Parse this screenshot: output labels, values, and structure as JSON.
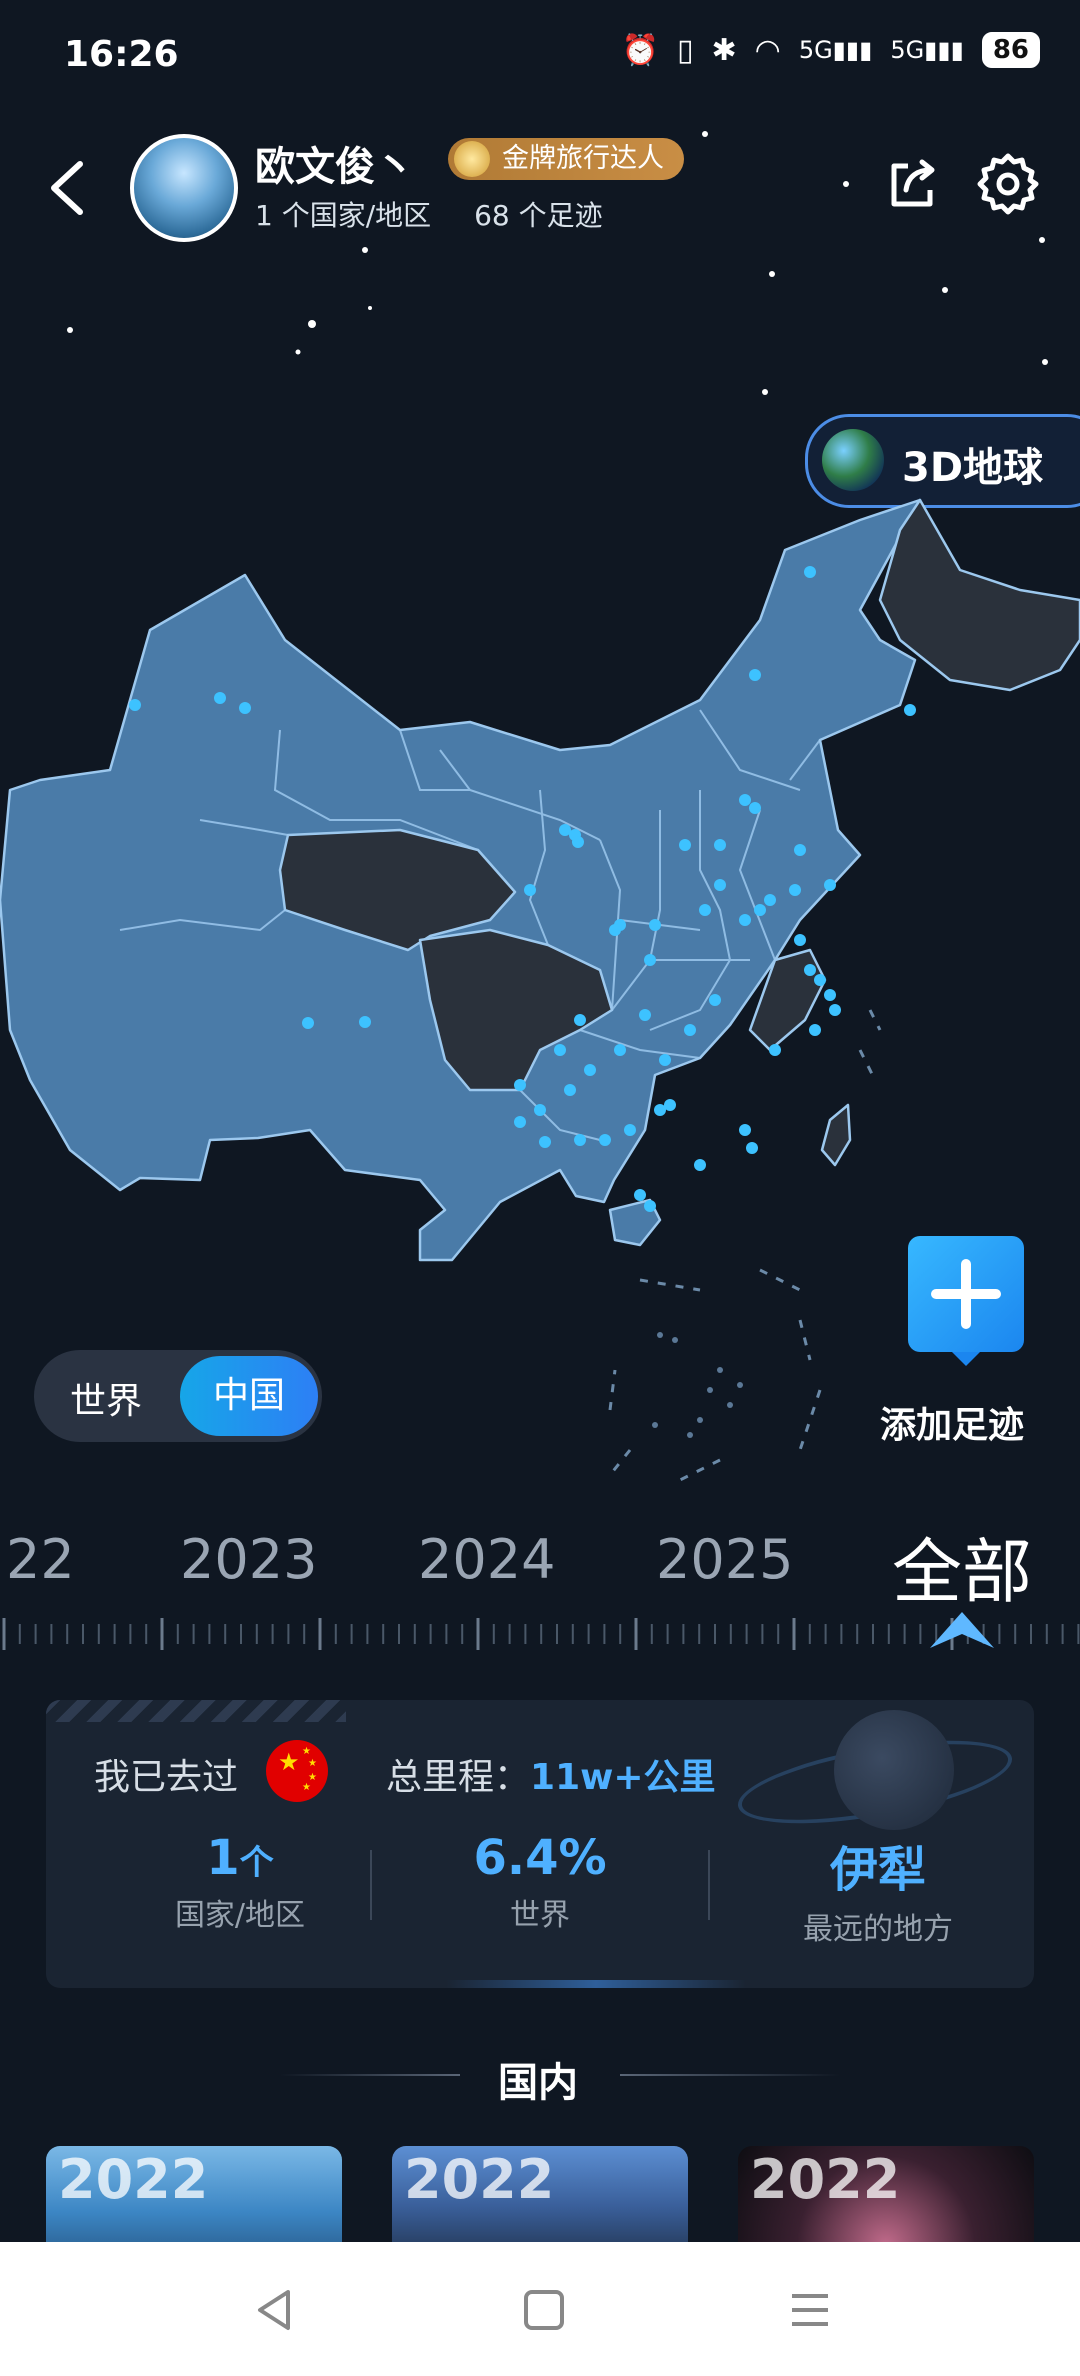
{
  "status_bar": {
    "time": "16:26",
    "battery": "86"
  },
  "profile": {
    "username": "欧文俊丶",
    "badge": "金牌旅行达人",
    "countries": "1 个国家/地区",
    "footprints": "68 个足迹"
  },
  "globe_button": "3D地球",
  "scope_toggle": {
    "world": "世界",
    "china": "中国",
    "selected": "中国"
  },
  "add_footprint": "添加足迹",
  "years": [
    "22",
    "2023",
    "2024",
    "2025",
    "全部"
  ],
  "summary": {
    "visited_label": "我已去过",
    "mileage_label": "总里程：",
    "mileage_value": "11w+公里",
    "stats": [
      {
        "value": "1",
        "unit": "个",
        "label": "国家/地区"
      },
      {
        "value": "6.4%",
        "unit": "",
        "label": "世界"
      },
      {
        "value": "伊犁",
        "unit": "",
        "label": "最远的地方"
      }
    ]
  },
  "section_title": "国内",
  "thumbnails": [
    "2022",
    "2022",
    "2022"
  ],
  "colors": {
    "accent": "#4fb0ff",
    "toggle_active": "#1e90ff",
    "map_visited": "#4a7ba8",
    "map_unvisited": "#2a313b"
  }
}
